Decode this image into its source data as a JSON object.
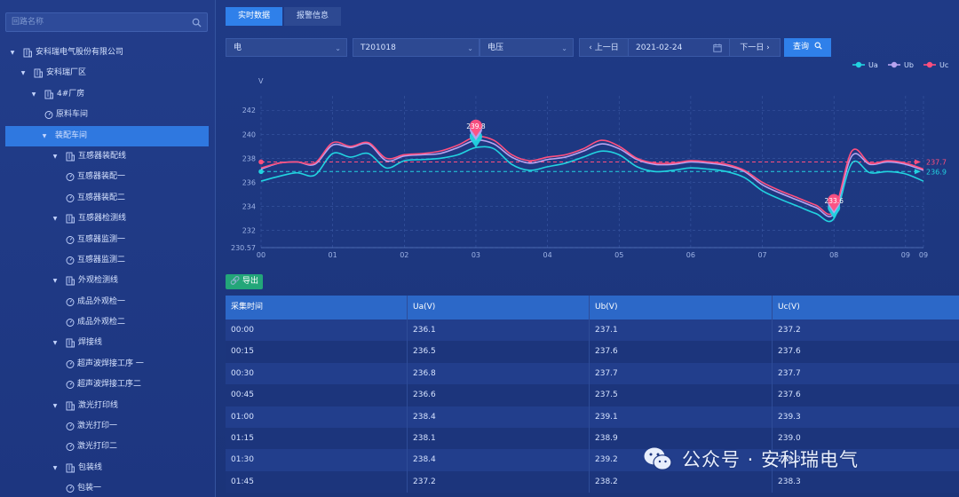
{
  "sidebar": {
    "search_placeholder": "回路名称",
    "tree": [
      {
        "label": "安科瑞电气股份有限公司",
        "level": 0,
        "caret": true,
        "icon": "building"
      },
      {
        "label": "安科瑞厂区",
        "level": 1,
        "caret": true,
        "icon": "building"
      },
      {
        "label": "4#厂房",
        "level": 2,
        "caret": true,
        "icon": "building"
      },
      {
        "label": "原料车间",
        "level": 3,
        "caret": false,
        "icon": "gauge"
      },
      {
        "label": "装配车间",
        "level": 3,
        "caret": true,
        "icon": "none",
        "active": true
      },
      {
        "label": "互感器装配线",
        "level": 4,
        "caret": true,
        "icon": "building"
      },
      {
        "label": "互感器装配一",
        "level": 5,
        "caret": false,
        "icon": "gauge"
      },
      {
        "label": "互感器装配二",
        "level": 5,
        "caret": false,
        "icon": "gauge"
      },
      {
        "label": "互感器检测线",
        "level": 4,
        "caret": true,
        "icon": "building"
      },
      {
        "label": "互感器监测一",
        "level": 5,
        "caret": false,
        "icon": "gauge"
      },
      {
        "label": "互感器监测二",
        "level": 5,
        "caret": false,
        "icon": "gauge"
      },
      {
        "label": "外观检测线",
        "level": 4,
        "caret": true,
        "icon": "building"
      },
      {
        "label": "成品外观检一",
        "level": 5,
        "caret": false,
        "icon": "gauge"
      },
      {
        "label": "成品外观检二",
        "level": 5,
        "caret": false,
        "icon": "gauge"
      },
      {
        "label": "焊接线",
        "level": 4,
        "caret": true,
        "icon": "building"
      },
      {
        "label": "超声波焊接工序 一",
        "level": 5,
        "caret": false,
        "icon": "gauge"
      },
      {
        "label": "超声波焊接工序二",
        "level": 5,
        "caret": false,
        "icon": "gauge"
      },
      {
        "label": "激光打印线",
        "level": 4,
        "caret": true,
        "icon": "building"
      },
      {
        "label": "激光打印一",
        "level": 5,
        "caret": false,
        "icon": "gauge"
      },
      {
        "label": "激光打印二",
        "level": 5,
        "caret": false,
        "icon": "gauge"
      },
      {
        "label": "包装线",
        "level": 4,
        "caret": true,
        "icon": "building"
      },
      {
        "label": "包装一",
        "level": 5,
        "caret": false,
        "icon": "gauge"
      }
    ]
  },
  "tabs": [
    {
      "label": "实时数据",
      "active": true
    },
    {
      "label": "报警信息",
      "active": false
    }
  ],
  "filters": {
    "type": "电",
    "device": "T201018",
    "param": "电压",
    "prev_day": "上一日",
    "date": "2021-02-24",
    "next_day": "下一日",
    "query": "查询"
  },
  "export_label": "导出",
  "colors": {
    "ua": "#22d3e0",
    "ub": "#b7a3f0",
    "uc": "#ff4f7e",
    "accent": "#2f80ea",
    "export": "#23a679"
  },
  "chart_data": {
    "type": "line",
    "ylabel": "V",
    "y_ticks": [
      "230.57",
      "232",
      "234",
      "236",
      "238",
      "240",
      "242"
    ],
    "ylim": [
      230.57,
      243.2
    ],
    "x_ticks": [
      "00",
      "01",
      "02",
      "03",
      "04",
      "05",
      "06",
      "07",
      "08",
      "09",
      "09"
    ],
    "xlim": [
      0,
      9.25
    ],
    "grid": true,
    "legend_position": "top-right",
    "x": [
      0,
      0.25,
      0.5,
      0.75,
      1,
      1.25,
      1.5,
      1.75,
      2,
      2.25,
      2.5,
      2.75,
      3,
      3.25,
      3.5,
      3.75,
      4,
      4.25,
      4.5,
      4.75,
      5,
      5.25,
      5.5,
      5.75,
      6,
      6.25,
      6.5,
      6.75,
      7,
      7.25,
      7.5,
      7.75,
      8,
      8.25,
      8.5,
      8.75,
      9,
      9.25
    ],
    "series": [
      {
        "name": "Ua",
        "values": [
          236.1,
          236.5,
          236.8,
          236.6,
          238.4,
          238.1,
          238.4,
          237.2,
          237.8,
          237.9,
          238.0,
          238.3,
          238.9,
          238.8,
          237.5,
          237.0,
          237.3,
          237.6,
          238.1,
          238.6,
          238.3,
          237.3,
          236.9,
          237.0,
          237.2,
          237.1,
          236.9,
          236.4,
          235.3,
          234.6,
          234.0,
          233.4,
          233.0,
          237.6,
          236.8,
          236.9,
          236.7,
          236.1
        ],
        "markers": [
          {
            "type": "max",
            "x": 3,
            "value": 238.9
          },
          {
            "type": "min",
            "x": 8,
            "value": 233.0
          }
        ],
        "average": 236.9
      },
      {
        "name": "Ub",
        "values": [
          237.1,
          237.6,
          237.7,
          237.5,
          239.1,
          238.9,
          239.2,
          237.8,
          238.2,
          238.3,
          238.4,
          238.9,
          239.5,
          239.2,
          238.1,
          237.6,
          237.9,
          238.1,
          238.6,
          239.2,
          238.8,
          237.9,
          237.5,
          237.5,
          237.7,
          237.6,
          237.4,
          236.9,
          235.8,
          235.1,
          234.5,
          233.9,
          233.4,
          238.2,
          237.5,
          237.7,
          237.5,
          237.0
        ],
        "markers": [
          {
            "type": "max",
            "x": 3,
            "value": 239.5
          },
          {
            "type": "min",
            "x": 8,
            "value": 233.4
          }
        ],
        "average": 237.7
      },
      {
        "name": "Uc",
        "values": [
          237.2,
          237.6,
          237.7,
          237.6,
          239.3,
          239.0,
          239.3,
          238.0,
          238.3,
          238.4,
          238.6,
          239.1,
          239.8,
          239.5,
          238.3,
          237.8,
          238.1,
          238.3,
          238.8,
          239.5,
          239.0,
          238.0,
          237.6,
          237.6,
          237.8,
          237.7,
          237.5,
          237.0,
          236.0,
          235.3,
          234.7,
          234.1,
          233.6,
          238.6,
          237.6,
          237.8,
          237.6,
          237.1
        ],
        "markers": [
          {
            "type": "max",
            "x": 3,
            "value": 239.8
          },
          {
            "type": "min",
            "x": 8,
            "value": 233.6
          }
        ],
        "average": 237.7
      }
    ],
    "marker_labels": [
      {
        "series": "Uc",
        "text": "239.8",
        "x": 3
      },
      {
        "series": "Uc",
        "text": "233.6",
        "x": 8
      }
    ],
    "avg_labels": [
      {
        "series": "Uc",
        "text": "237.7"
      },
      {
        "series": "Ua",
        "text": "236.9"
      }
    ]
  },
  "table": {
    "columns": [
      "采集时间",
      "Ua(V)",
      "Ub(V)",
      "Uc(V)"
    ],
    "rows": [
      [
        "00:00",
        "236.1",
        "237.1",
        "237.2"
      ],
      [
        "00:15",
        "236.5",
        "237.6",
        "237.6"
      ],
      [
        "00:30",
        "236.8",
        "237.7",
        "237.7"
      ],
      [
        "00:45",
        "236.6",
        "237.5",
        "237.6"
      ],
      [
        "01:00",
        "238.4",
        "239.1",
        "239.3"
      ],
      [
        "01:15",
        "238.1",
        "238.9",
        "239.0"
      ],
      [
        "01:30",
        "238.4",
        "239.2",
        "239.3"
      ],
      [
        "01:45",
        "237.2",
        "238.2",
        "238.3"
      ]
    ]
  },
  "watermark": "公众号 · 安科瑞电气"
}
